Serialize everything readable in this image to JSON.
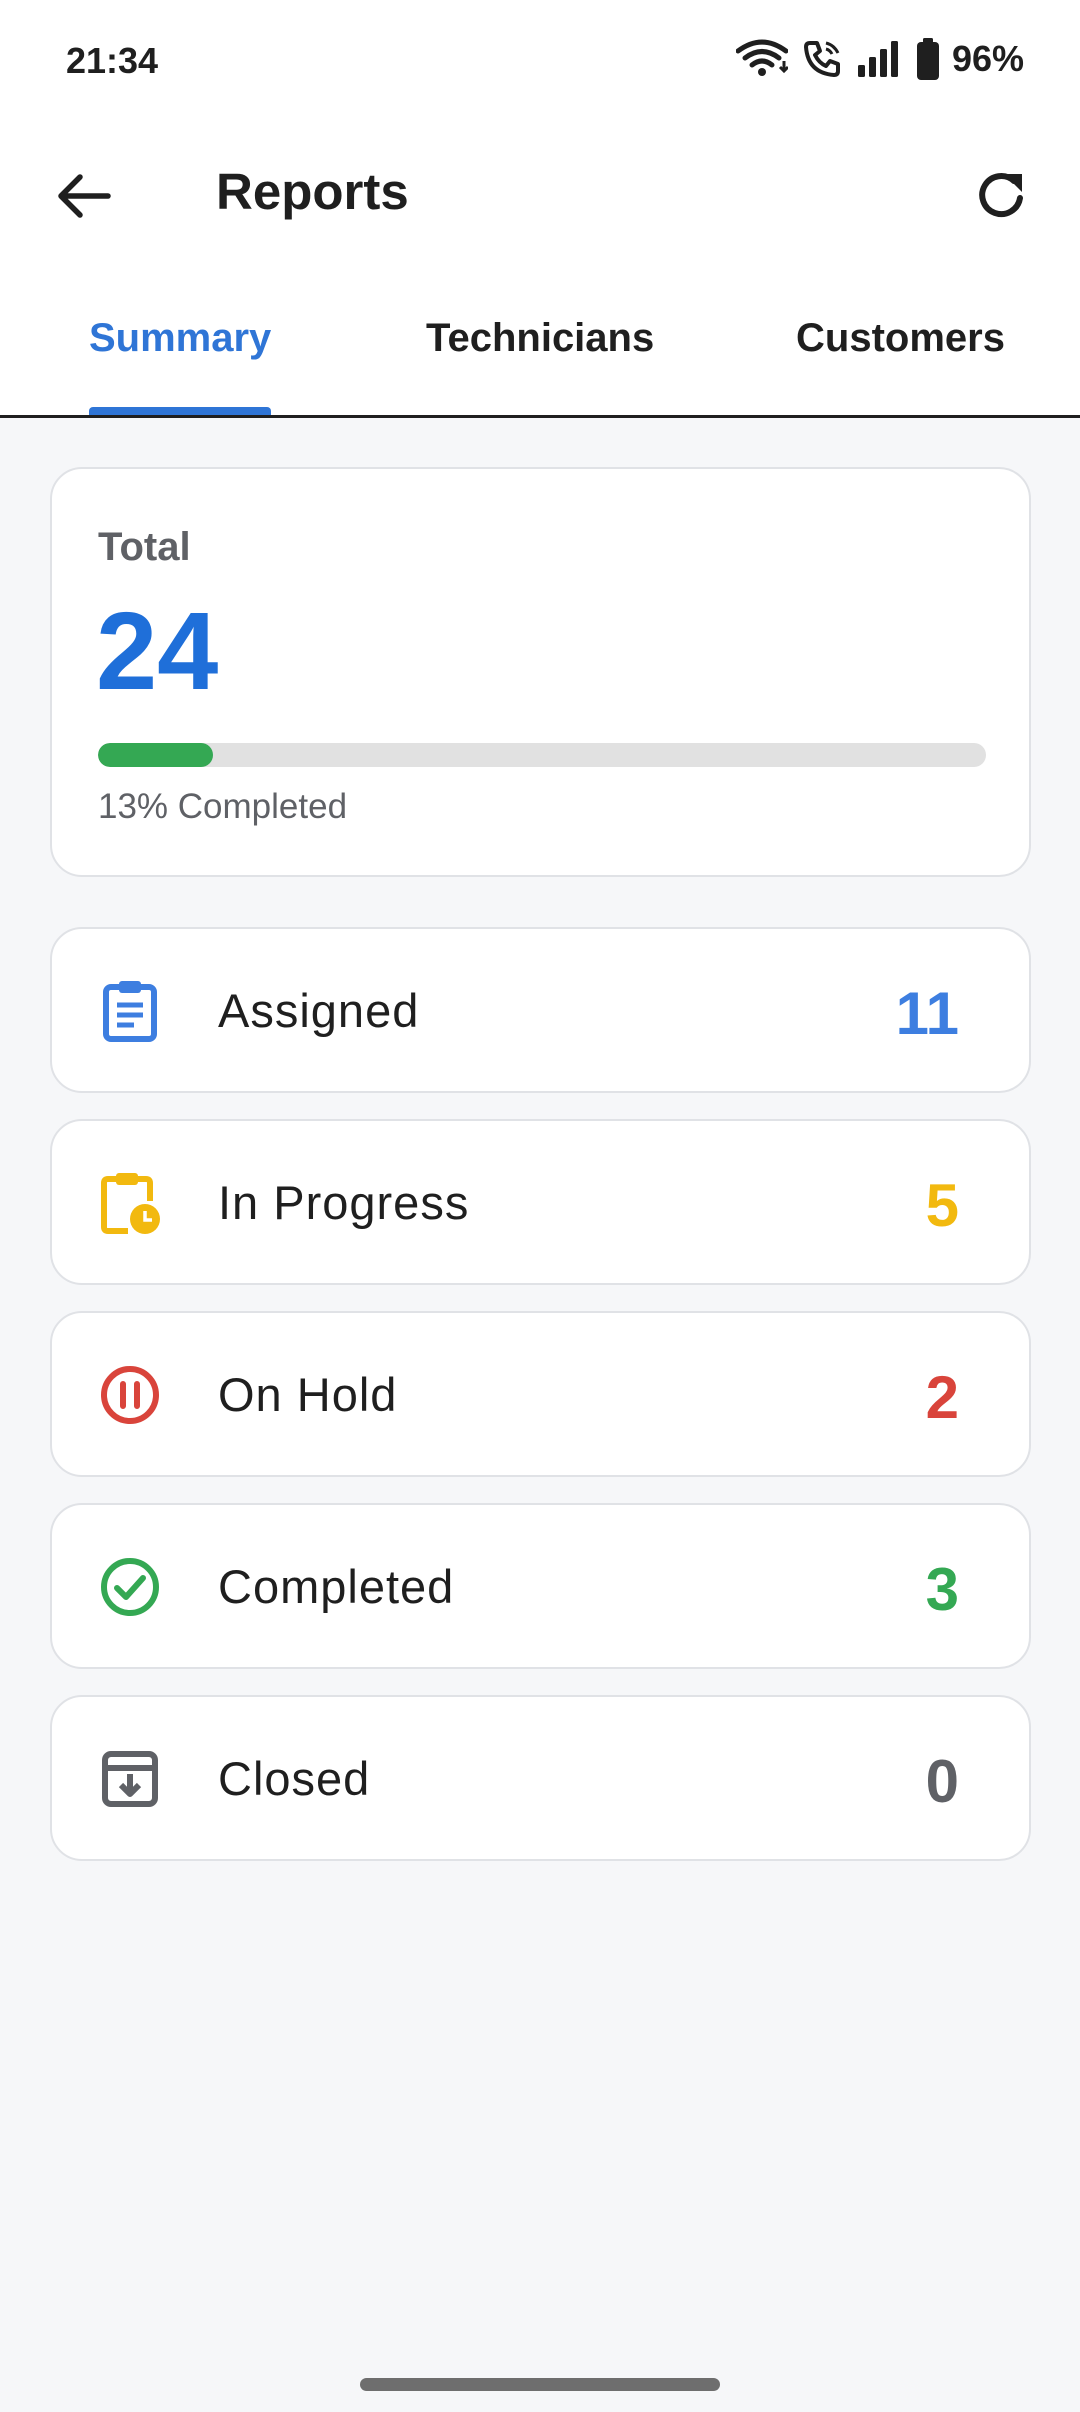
{
  "status_bar": {
    "time": "21:34",
    "battery": "96%",
    "icons": [
      "wifi-icon",
      "wifi-calling-icon",
      "signal-icon",
      "battery-icon"
    ]
  },
  "app_bar": {
    "title": "Reports",
    "back_icon": "arrow-left-icon",
    "refresh_icon": "refresh-icon"
  },
  "tabs": [
    {
      "label": "Summary",
      "active": true
    },
    {
      "label": "Technicians",
      "active": false
    },
    {
      "label": "Customers",
      "active": false
    }
  ],
  "total": {
    "label": "Total",
    "value": "24",
    "progress_percent": 13,
    "progress_text": "13% Completed",
    "progress_color": "#34a853"
  },
  "statuses": [
    {
      "label": "Assigned",
      "count": "11",
      "icon": "clipboard-list-icon",
      "color": "#3d7ee0"
    },
    {
      "label": "In Progress",
      "count": "5",
      "icon": "clipboard-clock-icon",
      "color": "#f2b90f"
    },
    {
      "label": "On Hold",
      "count": "2",
      "icon": "pause-circle-icon",
      "color": "#d9443b"
    },
    {
      "label": "Completed",
      "count": "3",
      "icon": "check-circle-icon",
      "color": "#34a853"
    },
    {
      "label": "Closed",
      "count": "0",
      "icon": "archive-icon",
      "color": "#5f6166"
    }
  ],
  "colors": {
    "accent": "#2f75d6",
    "total_value": "#1f6fd9"
  }
}
